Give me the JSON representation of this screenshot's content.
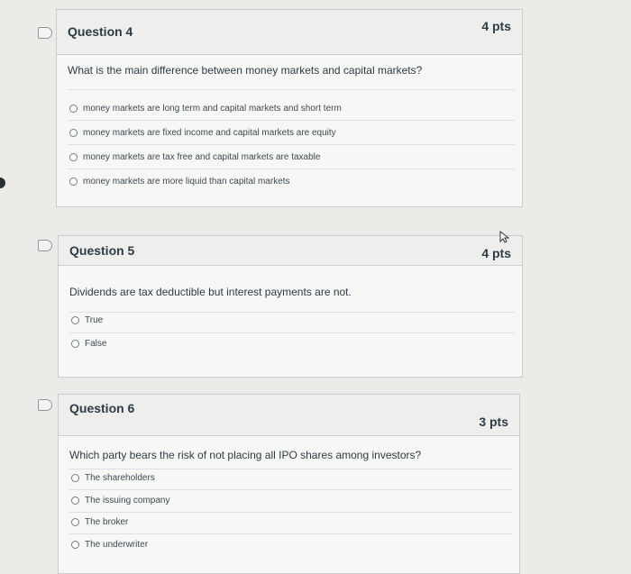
{
  "questions": [
    {
      "title": "Question 4",
      "points": "4 pts",
      "text": "What is the main difference between money markets and capital markets?",
      "answers": [
        "money markets are long term and capital markets and short term",
        "money markets are fixed income and capital markets are equity",
        "money markets are tax free and capital markets are taxable",
        "money markets are more liquid than capital markets"
      ]
    },
    {
      "title": "Question 5",
      "points": "4 pts",
      "text": "Dividends are tax deductible but interest payments are not.",
      "answers": [
        "True",
        "False"
      ]
    },
    {
      "title": "Question 6",
      "points": "3 pts",
      "text": "Which party bears the risk of not placing all IPO shares among investors?",
      "answers": [
        "The shareholders",
        "The issuing company",
        "The broker",
        "The underwriter"
      ]
    }
  ]
}
